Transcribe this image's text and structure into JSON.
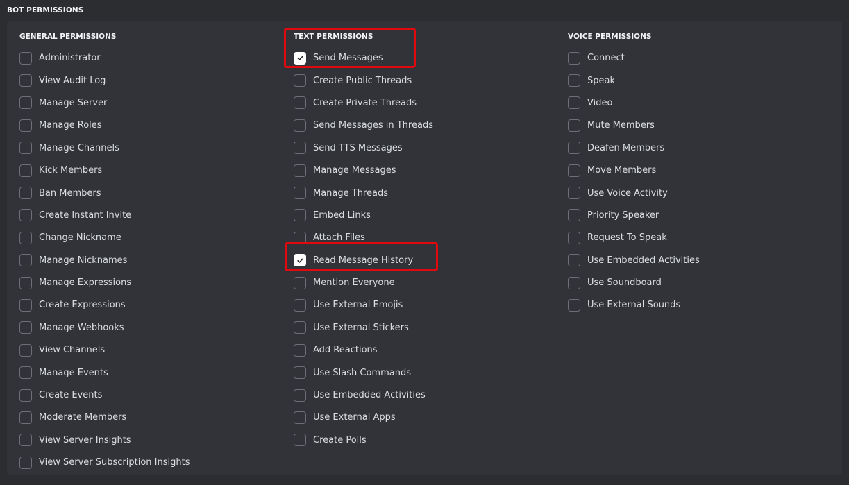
{
  "section_title": "BOT PERMISSIONS",
  "columns": {
    "general": {
      "heading": "GENERAL PERMISSIONS",
      "items": [
        {
          "label": "Administrator",
          "checked": false
        },
        {
          "label": "View Audit Log",
          "checked": false
        },
        {
          "label": "Manage Server",
          "checked": false
        },
        {
          "label": "Manage Roles",
          "checked": false
        },
        {
          "label": "Manage Channels",
          "checked": false
        },
        {
          "label": "Kick Members",
          "checked": false
        },
        {
          "label": "Ban Members",
          "checked": false
        },
        {
          "label": "Create Instant Invite",
          "checked": false
        },
        {
          "label": "Change Nickname",
          "checked": false
        },
        {
          "label": "Manage Nicknames",
          "checked": false
        },
        {
          "label": "Manage Expressions",
          "checked": false
        },
        {
          "label": "Create Expressions",
          "checked": false
        },
        {
          "label": "Manage Webhooks",
          "checked": false
        },
        {
          "label": "View Channels",
          "checked": false
        },
        {
          "label": "Manage Events",
          "checked": false
        },
        {
          "label": "Create Events",
          "checked": false
        },
        {
          "label": "Moderate Members",
          "checked": false
        },
        {
          "label": "View Server Insights",
          "checked": false
        },
        {
          "label": "View Server Subscription Insights",
          "checked": false
        }
      ]
    },
    "text": {
      "heading": "TEXT PERMISSIONS",
      "items": [
        {
          "label": "Send Messages",
          "checked": true
        },
        {
          "label": "Create Public Threads",
          "checked": false
        },
        {
          "label": "Create Private Threads",
          "checked": false
        },
        {
          "label": "Send Messages in Threads",
          "checked": false
        },
        {
          "label": "Send TTS Messages",
          "checked": false
        },
        {
          "label": "Manage Messages",
          "checked": false
        },
        {
          "label": "Manage Threads",
          "checked": false
        },
        {
          "label": "Embed Links",
          "checked": false
        },
        {
          "label": "Attach Files",
          "checked": false
        },
        {
          "label": "Read Message History",
          "checked": true
        },
        {
          "label": "Mention Everyone",
          "checked": false
        },
        {
          "label": "Use External Emojis",
          "checked": false
        },
        {
          "label": "Use External Stickers",
          "checked": false
        },
        {
          "label": "Add Reactions",
          "checked": false
        },
        {
          "label": "Use Slash Commands",
          "checked": false
        },
        {
          "label": "Use Embedded Activities",
          "checked": false
        },
        {
          "label": "Use External Apps",
          "checked": false
        },
        {
          "label": "Create Polls",
          "checked": false
        }
      ]
    },
    "voice": {
      "heading": "VOICE PERMISSIONS",
      "items": [
        {
          "label": "Connect",
          "checked": false
        },
        {
          "label": "Speak",
          "checked": false
        },
        {
          "label": "Video",
          "checked": false
        },
        {
          "label": "Mute Members",
          "checked": false
        },
        {
          "label": "Deafen Members",
          "checked": false
        },
        {
          "label": "Move Members",
          "checked": false
        },
        {
          "label": "Use Voice Activity",
          "checked": false
        },
        {
          "label": "Priority Speaker",
          "checked": false
        },
        {
          "label": "Request To Speak",
          "checked": false
        },
        {
          "label": "Use Embedded Activities",
          "checked": false
        },
        {
          "label": "Use Soundboard",
          "checked": false
        },
        {
          "label": "Use External Sounds",
          "checked": false
        }
      ]
    }
  },
  "icons": {
    "check": "checkmark-icon"
  },
  "colors": {
    "background": "#2b2d31",
    "panel": "#313338",
    "checkbox_border": "#6d6f78",
    "checkbox_checked": "#ffffff",
    "highlight": "#e1080e",
    "text": "#dbdee1"
  }
}
